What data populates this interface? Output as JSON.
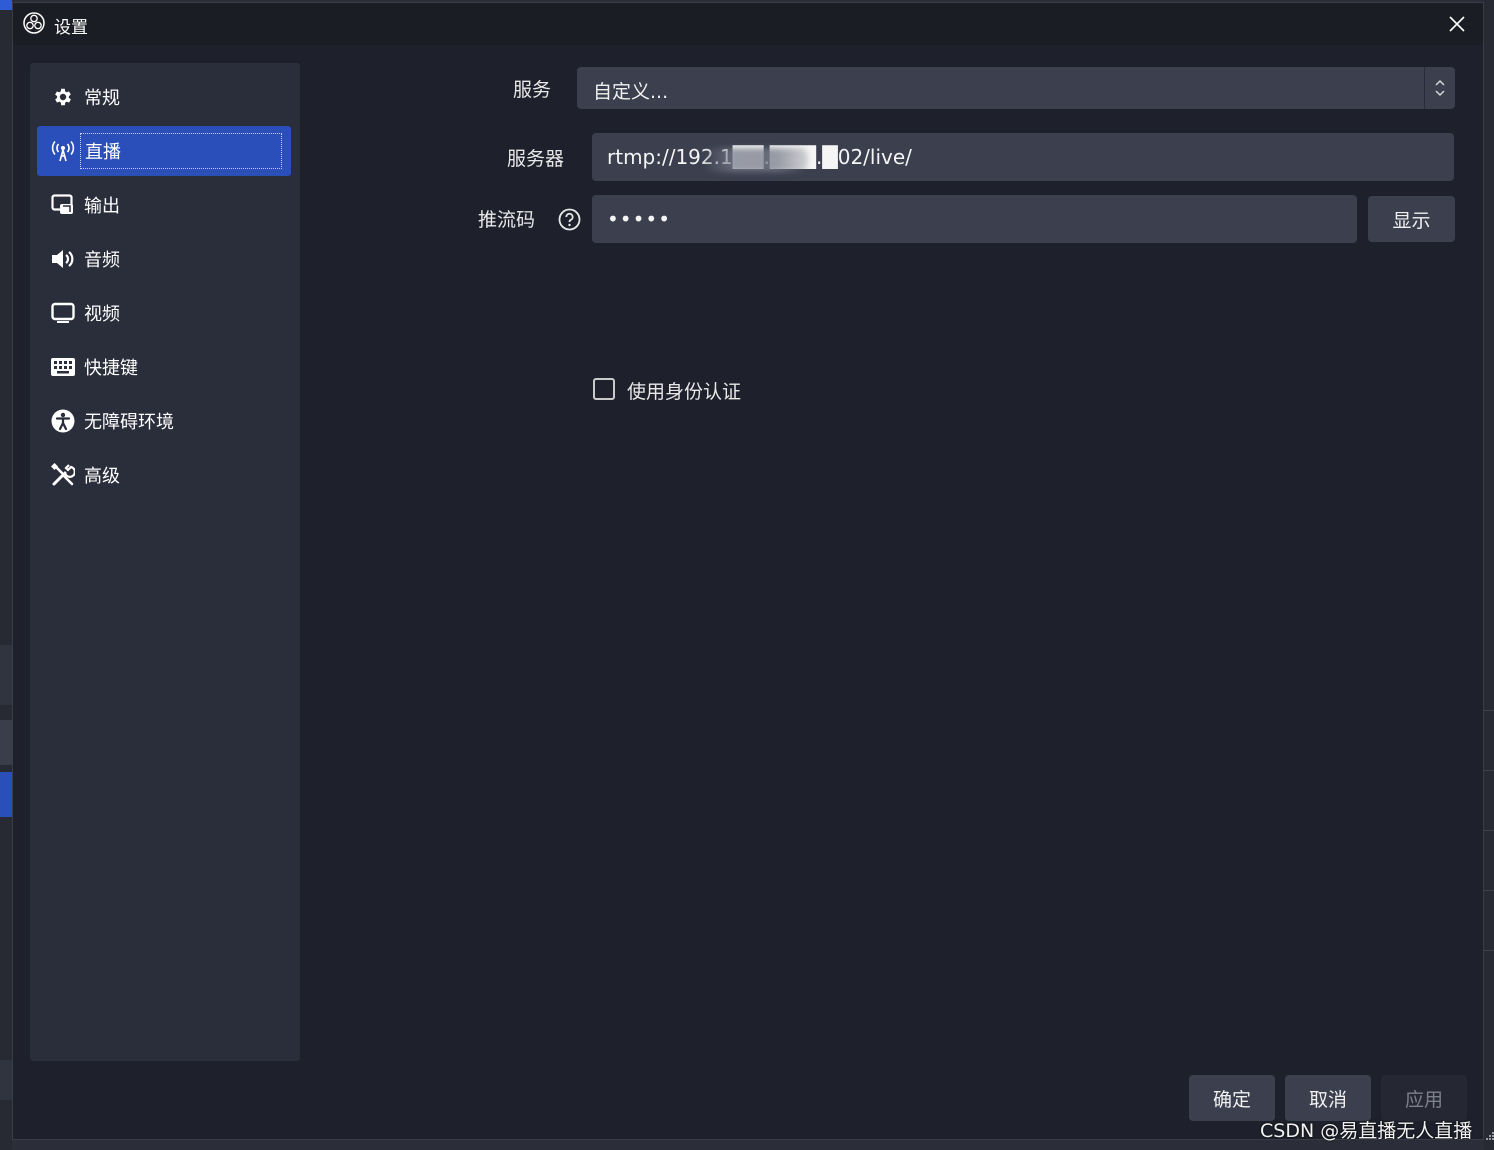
{
  "window": {
    "title": "设置"
  },
  "sidebar": {
    "items": [
      {
        "label": "常规",
        "icon": "gear-icon"
      },
      {
        "label": "直播",
        "icon": "broadcast-antenna-icon",
        "active": true
      },
      {
        "label": "输出",
        "icon": "output-screen-icon"
      },
      {
        "label": "音频",
        "icon": "speaker-icon"
      },
      {
        "label": "视频",
        "icon": "monitor-icon"
      },
      {
        "label": "快捷键",
        "icon": "keyboard-icon"
      },
      {
        "label": "无障碍环境",
        "icon": "accessibility-icon"
      },
      {
        "label": "高级",
        "icon": "tools-icon"
      }
    ]
  },
  "stream": {
    "service_label": "服务",
    "service_value": "自定义...",
    "server_label": "服务器",
    "server_value": "rtmp://192.1██.███.█02/live/",
    "stream_key_label": "推流码",
    "stream_key_value": "•••••",
    "show_button": "显示",
    "use_auth_label": "使用身份认证",
    "use_auth_checked": false
  },
  "footer": {
    "ok_label": "确定",
    "cancel_label": "取消",
    "apply_label": "应用"
  },
  "watermark": "CSDN @易直播无人直播",
  "colors": {
    "dialog_bg": "#1e212b",
    "sidebar_bg": "#2a2d3a",
    "active_item": "#2b4fba",
    "field_bg": "#3b3f4e"
  }
}
